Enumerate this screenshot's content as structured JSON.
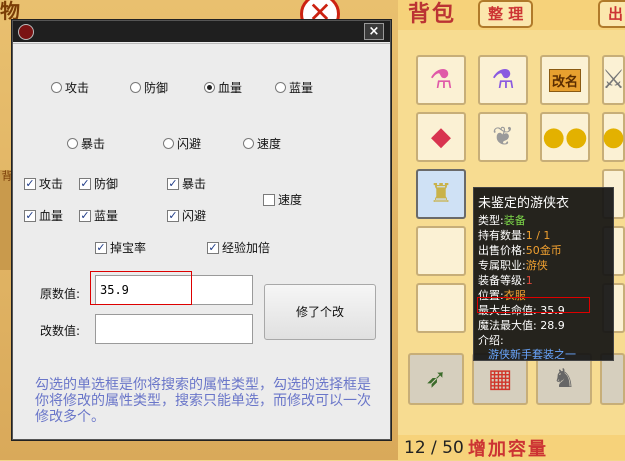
{
  "background": {
    "title_art": "物",
    "left_tag": "背"
  },
  "window": {
    "close_label": "×",
    "search_type_radios": [
      {
        "label": "攻击",
        "checked": false
      },
      {
        "label": "防御",
        "checked": false
      },
      {
        "label": "血量",
        "checked": true
      },
      {
        "label": "蓝量",
        "checked": false
      },
      {
        "label": "暴击",
        "checked": false
      },
      {
        "label": "闪避",
        "checked": false
      },
      {
        "label": "速度",
        "checked": false
      }
    ],
    "modify_type_checks": [
      {
        "label": "攻击",
        "checked": true
      },
      {
        "label": "防御",
        "checked": true
      },
      {
        "label": "暴击",
        "checked": true
      },
      {
        "label": "速度",
        "checked": false
      },
      {
        "label": "血量",
        "checked": true
      },
      {
        "label": "蓝量",
        "checked": true
      },
      {
        "label": "闪避",
        "checked": true
      },
      {
        "label": "掉宝率",
        "checked": true
      },
      {
        "label": "经验加倍",
        "checked": true
      }
    ],
    "original_label": "原数值:",
    "original_value": "35.9",
    "modified_label": "改数值:",
    "modified_value": "",
    "modify_button": "修了个改",
    "hint": "勾选的单选框是你将搜索的属性类型，勾选的选择框是你将修改的属性类型，搜索只能单选，而修改可以一次修改多个。"
  },
  "inventory": {
    "title": "背包",
    "tab_sort": "整 理",
    "tab_other": "出",
    "rename_label": "改名",
    "capacity": "12 / 50",
    "expand_label": "增加容量",
    "item_icons": [
      "potion-pink-icon",
      "potion-purple-icon",
      "rename-scroll-icon",
      "sword-icon",
      "gem-icon",
      "wing-icon",
      "coin-icon",
      "coin-icon",
      "armor-icon",
      "bow-icon",
      "cake-icon",
      "dragon-icon"
    ]
  },
  "tooltip": {
    "title": "未鉴定的游侠衣",
    "type_label": "类型:",
    "type_value": "装备",
    "count_label": "持有数量:",
    "count_value": "1 / 1",
    "price_label": "出售价格:",
    "price_value": "50金币",
    "class_label": "专属职业:",
    "class_value": "游侠",
    "level_label": "装备等级:",
    "level_value": "1",
    "slot_label": "位置:",
    "slot_value": "衣服",
    "hp_label": "最大生命值",
    "hp_value": ": 35.9",
    "mp_label": "魔法最大值",
    "mp_value": ": 28.9",
    "intro_label": "介绍:",
    "set_text": "游侠新手套装之一"
  },
  "colors": {
    "accent_red": "#d00000",
    "hint_blue": "#6a76c9",
    "tooltip_bg": "#141414"
  }
}
